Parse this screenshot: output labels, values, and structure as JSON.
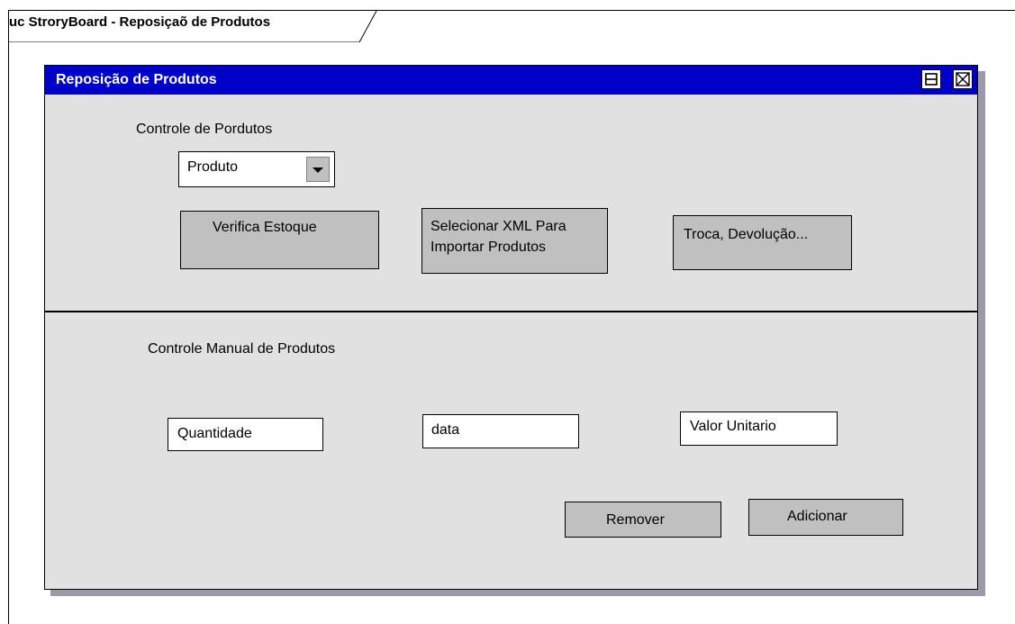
{
  "frame": {
    "title": "uc StroryBoard - Reposiçaõ de Produtos"
  },
  "window": {
    "title": "Reposição de Produtos",
    "buttons": {
      "restore_icon": "restore-icon",
      "close_icon": "close-icon"
    },
    "colors": {
      "titlebar": "#0000c8",
      "body": "#e1e1e1",
      "button": "#c0c0c0"
    }
  },
  "top_section": {
    "heading": "Controle de Pordutos",
    "product_select": {
      "value": "Produto",
      "icon": "dropdown-arrow-icon"
    },
    "buttons": {
      "verify_stock": "Verifica Estoque",
      "select_xml_line1": "Selecionar XML Para",
      "select_xml_line2": "Importar Produtos",
      "exchange_return": "Troca, Devolução..."
    }
  },
  "bottom_section": {
    "heading": "Controle Manual de Produtos",
    "fields": {
      "quantity": "Quantidade",
      "date": "data",
      "unit_value": "Valor Unitario"
    },
    "buttons": {
      "remove": "Remover",
      "add": "Adicionar"
    }
  }
}
